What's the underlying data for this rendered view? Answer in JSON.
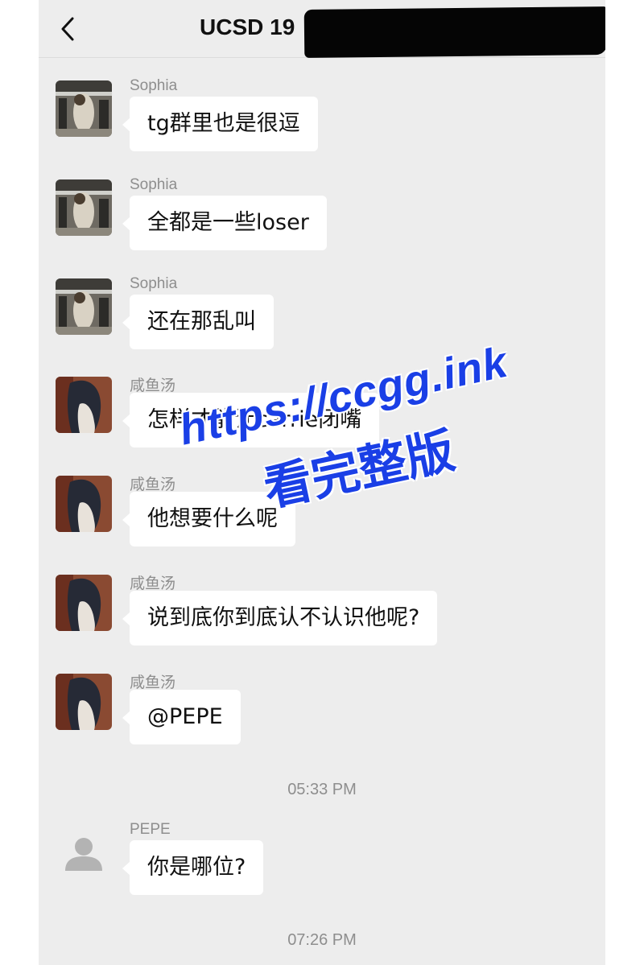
{
  "header": {
    "back_icon": "chevron-left-icon",
    "title": "UCSD 19"
  },
  "messages": [
    {
      "sender": "Sophia",
      "text": "tg群里也是很逗",
      "avatar": "sophia-photo"
    },
    {
      "sender": "Sophia",
      "text": "全都是一些loser",
      "avatar": "sophia-photo"
    },
    {
      "sender": "Sophia",
      "text": "还在那乱叫",
      "avatar": "sophia-photo"
    },
    {
      "sender": "咸鱼汤",
      "text": "怎样才能让carrie闭嘴",
      "avatar": "xianyutang-photo"
    },
    {
      "sender": "咸鱼汤",
      "text": "他想要什么呢",
      "avatar": "xianyutang-photo"
    },
    {
      "sender": "咸鱼汤",
      "text": "说到底你到底认不认识他呢?",
      "avatar": "xianyutang-photo"
    },
    {
      "sender": "咸鱼汤",
      "text": "@PEPE",
      "avatar": "xianyutang-photo"
    },
    {
      "sender": "PEPE",
      "text": "你是哪位?",
      "avatar": "default-user-icon"
    }
  ],
  "timestamps": [
    "05:33 PM",
    "07:26 PM"
  ],
  "watermark": {
    "url": "https://ccgg.ink",
    "caption": "看完整版",
    "color": "#1a3fe6"
  },
  "colors": {
    "background": "#ededed",
    "bubble": "#ffffff",
    "meta_text": "#8e8e8e"
  }
}
